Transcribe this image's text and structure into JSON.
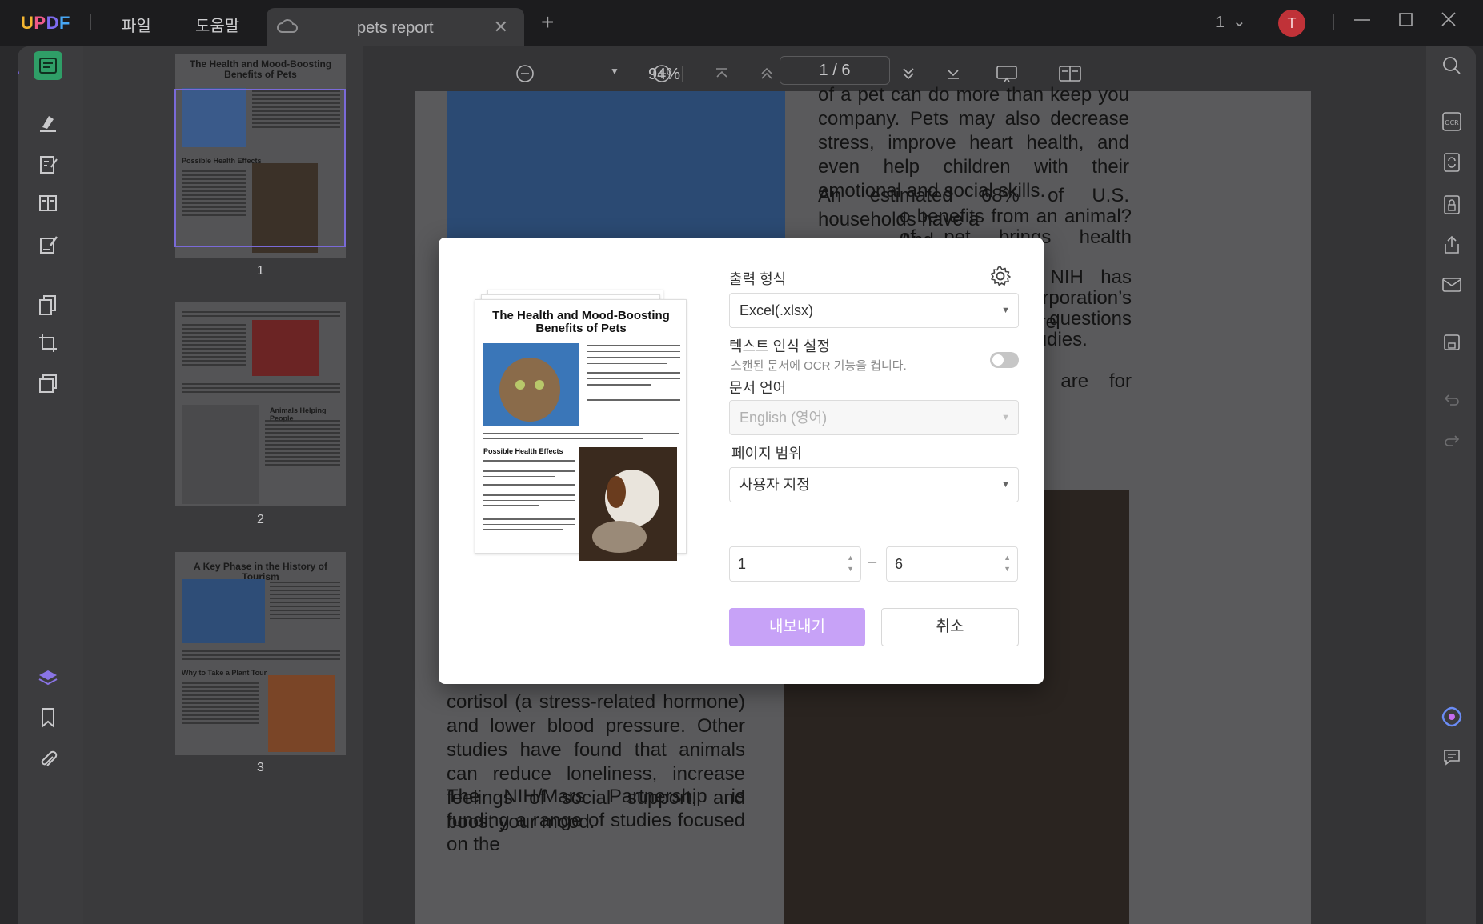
{
  "titlebar": {
    "logo": {
      "u": "U",
      "p": "P",
      "d": "D",
      "f": "F"
    },
    "menu": [
      "파일",
      "도움말"
    ],
    "tab_title": "pets report",
    "page_indicator": "1",
    "avatar_letter": "T"
  },
  "toolbar": {
    "zoom": "94%",
    "page_current": "1",
    "page_total": "6",
    "page_display": "1 / 6"
  },
  "thumbnails": [
    {
      "number": "1",
      "title": "The Health and Mood-Boosting Benefits of Pets",
      "subheading": "Possible Health Effects"
    },
    {
      "number": "2",
      "title": "",
      "subheading": "Animals Helping People"
    },
    {
      "number": "3",
      "title": "A Key Phase in the History of Tourism",
      "subheading": "Why to Take a Plant Tour"
    }
  ],
  "document": {
    "top_right": "of a pet can do more than keep you company. Pets may also decrease stress, improve heart health, and even help children with their emotional and social skills.",
    "p2a": "An estimated 68% of U.S. households have a",
    "p2b": "o benefits from an animal? And",
    "p2c": "of pet brings health benefits?",
    "p3a": "ust 10 years, NIH has partnered",
    "p3b": "rs Corporation’s WALTHAM Centre",
    "p3c": "trition to answer questions like",
    "p3d": "ding research studies.",
    "p4": "health benefits are for different",
    "p5": "Interacting with animals has been shown to decrease levels of cortisol (a stress-related hormone) and lower blood pressure. Other studies have found that animals can reduce loneliness, increase feelings of social support, and boost your mood.",
    "p6": "The NIH/Mars Partnership is funding a range of studies focused on the"
  },
  "dialog": {
    "preview": {
      "title": "The Health and Mood-Boosting Benefits of Pets",
      "subheading": "Possible Health Effects"
    },
    "output_format_label": "출력 형식",
    "output_format_value": "Excel(.xlsx)",
    "ocr_label": "텍스트 인식 설정",
    "ocr_hint": "스캔된 문서에 OCR 기능을 켭니다.",
    "ocr_enabled": false,
    "language_label": "문서 언어",
    "language_value": "English (영어)",
    "page_range_label": "페이지 범위",
    "page_range_value": "사용자 지정",
    "range_from": "1",
    "range_dash": "–",
    "range_to": "6",
    "export_button": "내보내기",
    "cancel_button": "취소"
  },
  "colors": {
    "accent": "#c7a2f7",
    "rail_active": "#2f9e67",
    "avatar": "#c03238"
  }
}
